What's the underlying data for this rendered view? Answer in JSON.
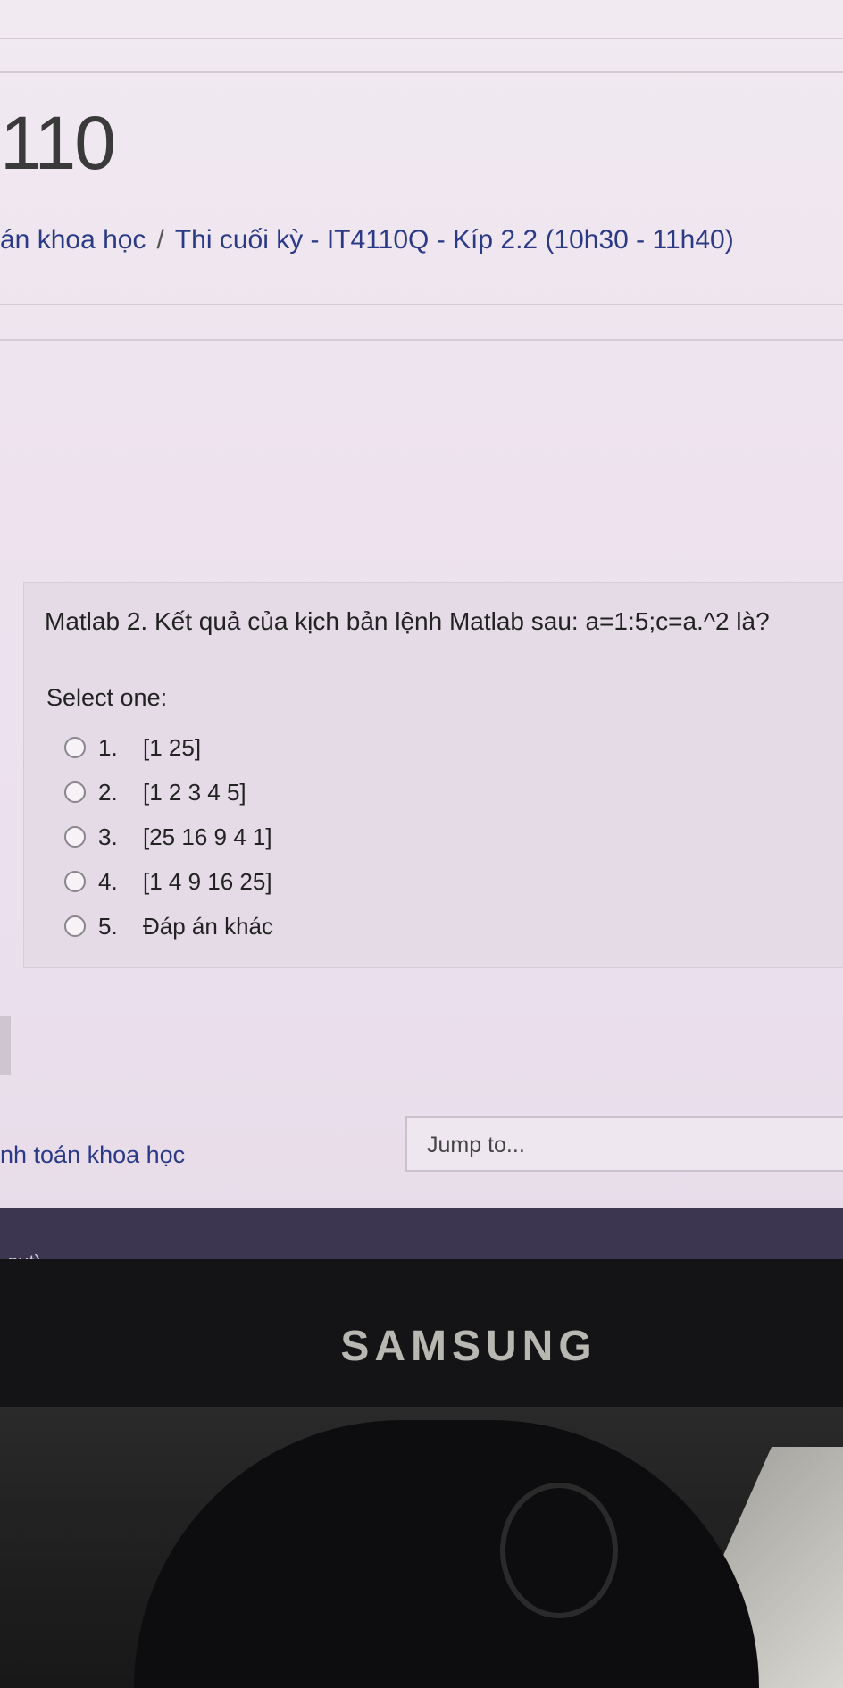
{
  "header": {
    "course_code": "110",
    "breadcrumb": {
      "parent": "án khoa học",
      "separator": "/",
      "current": "Thi cuối kỳ - IT4110Q - Kíp 2.2 (10h30 - 11h40)"
    }
  },
  "question": {
    "text": "Matlab 2. Kết quả của kịch bản lệnh Matlab sau: a=1:5;c=a.^2 là?",
    "select_label": "Select one:",
    "options": [
      {
        "num": "1.",
        "label": "[1 25]"
      },
      {
        "num": "2.",
        "label": "[1 2 3 4 5]"
      },
      {
        "num": "3.",
        "label": "[25 16 9 4 1]"
      },
      {
        "num": "4.",
        "label": "[1 4 9 16 25]"
      },
      {
        "num": "5.",
        "label": "Đáp án khác"
      }
    ]
  },
  "footer": {
    "course_link": "nh toán khoa học",
    "jump_placeholder": "Jump to...",
    "logout_partial": "out)"
  },
  "monitor": {
    "brand": "SAMSUNG"
  }
}
